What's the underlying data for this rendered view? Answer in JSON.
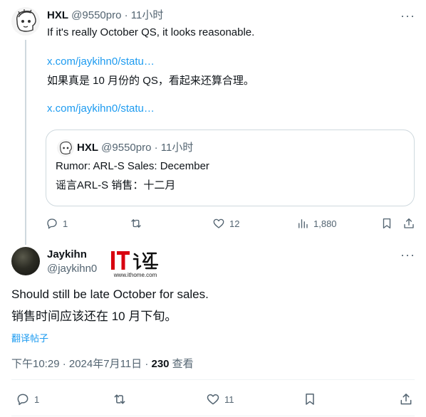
{
  "first_tweet": {
    "name": "HXL",
    "handle": "@9550pro",
    "separator": "·",
    "time": "11小时",
    "text_en": "If it's really October QS, it looks reasonable.",
    "link1": "x.com/jaykihn0/statu…",
    "text_zh": "如果真是 10 月份的 QS，看起来还算合理。",
    "link2": "x.com/jaykihn0/statu…",
    "quote": {
      "name": "HXL",
      "handle": "@9550pro",
      "separator": "·",
      "time": "11小时",
      "line_en": "Rumor: ARL-S Sales: December",
      "line_zh": "谣言ARL-S 销售：十二月"
    },
    "actions": {
      "replies": "1",
      "reposts": "",
      "likes": "12",
      "views": "1,880"
    }
  },
  "second_tweet": {
    "name": "Jaykihn",
    "handle": "@jaykihn0",
    "text_en": "Should still be late October for sales.",
    "text_zh": "销售时间应该还在 10 月下旬。",
    "translate_label": "翻译帖子",
    "timestamp": "下午10:29 · 2024年7月11日 · ",
    "views_count": "230",
    "views_label": " 查看",
    "actions": {
      "replies": "1",
      "reposts": "",
      "likes": "11"
    }
  },
  "watermark": {
    "logo": "IT之家",
    "url": "www.ithome.com"
  },
  "icons": {
    "more": "more-icon",
    "reply": "reply-icon",
    "repost": "repost-icon",
    "like": "heart-icon",
    "views": "views-icon",
    "bookmark": "bookmark-icon",
    "share": "share-icon"
  },
  "colors": {
    "link": "#1d9bf0",
    "muted": "#536471",
    "text": "#0f1419",
    "border": "#cfd9de",
    "watermark_red": "#d8000f"
  }
}
